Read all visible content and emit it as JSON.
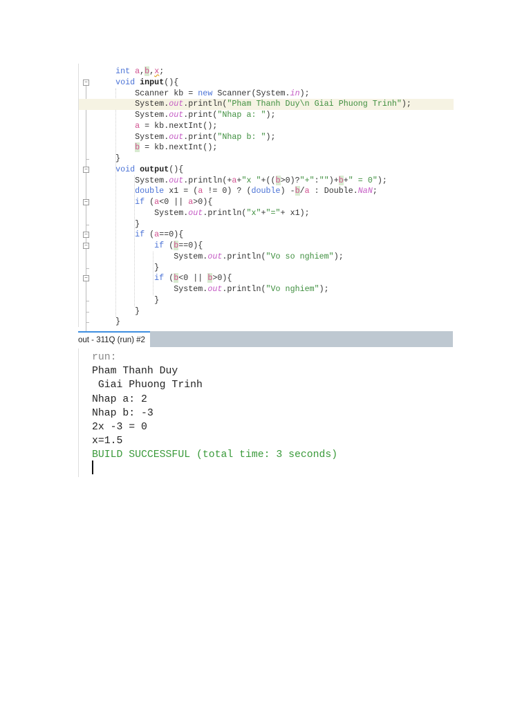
{
  "code": {
    "lines": [
      {
        "tokens": [
          [
            "p",
            "    "
          ],
          [
            "k",
            "int"
          ],
          [
            "p",
            " "
          ],
          [
            "v",
            "a"
          ],
          [
            "p",
            ","
          ],
          [
            "vb",
            "b"
          ],
          [
            "p",
            ","
          ],
          [
            "vx",
            "x"
          ],
          [
            "p",
            ";"
          ]
        ]
      },
      {
        "tokens": [
          [
            "p",
            "    "
          ],
          [
            "k",
            "void"
          ],
          [
            "p",
            " "
          ],
          [
            "m",
            "input"
          ],
          [
            "p",
            "(){"
          ]
        ]
      },
      {
        "tokens": [
          [
            "p",
            "        Scanner kb = "
          ],
          [
            "k",
            "new"
          ],
          [
            "p",
            " Scanner(System."
          ],
          [
            "f",
            "in"
          ],
          [
            "p",
            ");"
          ]
        ]
      },
      {
        "highlight": true,
        "tokens": [
          [
            "p",
            "        System."
          ],
          [
            "f",
            "out"
          ],
          [
            "p",
            ".println("
          ],
          [
            "s",
            "\"Pham Thanh Duy\\n Giai Phuong Trinh\""
          ],
          [
            "p",
            ");"
          ]
        ]
      },
      {
        "tokens": [
          [
            "p",
            "        System."
          ],
          [
            "f",
            "out"
          ],
          [
            "p",
            ".print("
          ],
          [
            "s",
            "\"Nhap a: \""
          ],
          [
            "p",
            ");"
          ]
        ]
      },
      {
        "tokens": [
          [
            "p",
            "        "
          ],
          [
            "v",
            "a"
          ],
          [
            "p",
            " = kb.nextInt();"
          ]
        ]
      },
      {
        "tokens": [
          [
            "p",
            "        System."
          ],
          [
            "f",
            "out"
          ],
          [
            "p",
            ".print("
          ],
          [
            "s",
            "\"Nhap b: \""
          ],
          [
            "p",
            ");"
          ]
        ]
      },
      {
        "tokens": [
          [
            "p",
            "        "
          ],
          [
            "vb",
            "b"
          ],
          [
            "p",
            " = kb.nextInt();"
          ]
        ]
      },
      {
        "tokens": [
          [
            "p",
            "    }"
          ]
        ]
      },
      {
        "tokens": [
          [
            "p",
            "    "
          ],
          [
            "k",
            "void"
          ],
          [
            "p",
            " "
          ],
          [
            "m",
            "output"
          ],
          [
            "p",
            "(){"
          ]
        ]
      },
      {
        "tokens": [
          [
            "p",
            "        System."
          ],
          [
            "f",
            "out"
          ],
          [
            "p",
            ".println(+"
          ],
          [
            "v",
            "a"
          ],
          [
            "p",
            "+"
          ],
          [
            "s",
            "\"x \""
          ],
          [
            "p",
            "+(("
          ],
          [
            "vb",
            "b"
          ],
          [
            "p",
            ">0)?"
          ],
          [
            "s",
            "\"+\""
          ],
          [
            "p",
            ":"
          ],
          [
            "s",
            "\"\""
          ],
          [
            "p",
            ")+"
          ],
          [
            "vb",
            "b"
          ],
          [
            "p",
            "+"
          ],
          [
            "s",
            "\" = 0\""
          ],
          [
            "p",
            ");"
          ]
        ]
      },
      {
        "tokens": [
          [
            "p",
            "        "
          ],
          [
            "k",
            "double"
          ],
          [
            "p",
            " x1 = ("
          ],
          [
            "v",
            "a"
          ],
          [
            "p",
            " != 0) ? ("
          ],
          [
            "k",
            "double"
          ],
          [
            "p",
            ") -"
          ],
          [
            "vb",
            "b"
          ],
          [
            "p",
            "/"
          ],
          [
            "v",
            "a"
          ],
          [
            "p",
            " : Double."
          ],
          [
            "f",
            "NaN"
          ],
          [
            "p",
            ";"
          ]
        ]
      },
      {
        "tokens": [
          [
            "p",
            "        "
          ],
          [
            "k",
            "if"
          ],
          [
            "p",
            " ("
          ],
          [
            "v",
            "a"
          ],
          [
            "p",
            "<0 || "
          ],
          [
            "v",
            "a"
          ],
          [
            "p",
            ">0){"
          ]
        ]
      },
      {
        "tokens": [
          [
            "p",
            "            System."
          ],
          [
            "f",
            "out"
          ],
          [
            "p",
            ".println("
          ],
          [
            "s",
            "\"x\""
          ],
          [
            "p",
            "+"
          ],
          [
            "s",
            "\"=\""
          ],
          [
            "p",
            "+ x1);"
          ]
        ]
      },
      {
        "tokens": [
          [
            "p",
            "        }"
          ]
        ]
      },
      {
        "tokens": [
          [
            "p",
            "        "
          ],
          [
            "k",
            "if"
          ],
          [
            "p",
            " ("
          ],
          [
            "v",
            "a"
          ],
          [
            "p",
            "==0){"
          ]
        ]
      },
      {
        "tokens": [
          [
            "p",
            "            "
          ],
          [
            "k",
            "if"
          ],
          [
            "p",
            " ("
          ],
          [
            "vb",
            "b"
          ],
          [
            "p",
            "==0){"
          ]
        ]
      },
      {
        "tokens": [
          [
            "p",
            "                System."
          ],
          [
            "f",
            "out"
          ],
          [
            "p",
            ".println("
          ],
          [
            "s",
            "\"Vo so nghiem\""
          ],
          [
            "p",
            ");"
          ]
        ]
      },
      {
        "tokens": [
          [
            "p",
            "            }"
          ]
        ]
      },
      {
        "tokens": [
          [
            "p",
            "            "
          ],
          [
            "k",
            "if"
          ],
          [
            "p",
            " ("
          ],
          [
            "vb",
            "b"
          ],
          [
            "p",
            "<0 || "
          ],
          [
            "vb",
            "b"
          ],
          [
            "p",
            ">0){"
          ]
        ]
      },
      {
        "tokens": [
          [
            "p",
            "                System."
          ],
          [
            "f",
            "out"
          ],
          [
            "p",
            ".println("
          ],
          [
            "s",
            "\"Vo nghiem\""
          ],
          [
            "p",
            ");"
          ]
        ]
      },
      {
        "tokens": [
          [
            "p",
            "            }"
          ]
        ]
      },
      {
        "tokens": [
          [
            "p",
            "        }"
          ]
        ]
      },
      {
        "tokens": [
          [
            "p",
            "    }"
          ]
        ]
      }
    ],
    "fold_lines": [
      1,
      9,
      12,
      15,
      16,
      19
    ],
    "fold_end_lines": [
      8,
      14,
      18,
      21,
      22,
      23
    ]
  },
  "output_tab": {
    "label": "out - 311Q (run) #2",
    "close": "×"
  },
  "output": {
    "lines": [
      {
        "style": "gray",
        "text": "run:"
      },
      {
        "style": "normal",
        "text": "Pham Thanh Duy"
      },
      {
        "style": "normal",
        "text": " Giai Phuong Trinh"
      },
      {
        "style": "normal",
        "text": "Nhap a: 2"
      },
      {
        "style": "normal",
        "text": "Nhap b: -3"
      },
      {
        "style": "normal",
        "text": "2x -3 = 0"
      },
      {
        "style": "normal",
        "text": "x=1.5"
      },
      {
        "style": "green",
        "text": "BUILD SUCCESSFUL (total time: 3 seconds)"
      }
    ]
  }
}
